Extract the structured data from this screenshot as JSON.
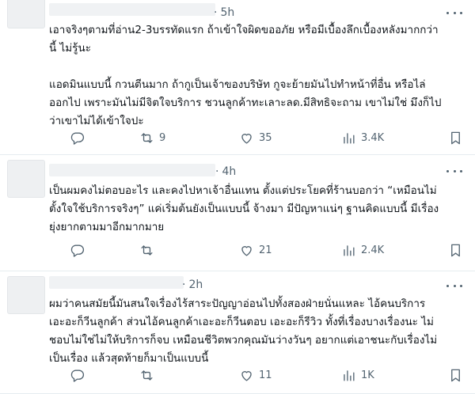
{
  "posts": [
    {
      "time": "5h",
      "lines": [
        "เอาจริงๆตามที่อ่าน2-3บรรทัดแรก ถ้าเข้าใจผิดขออภัย หรือมีเบื้องลึกเบื้องหลังมากกว่า",
        "นี้ ไม่รู้นะ",
        "",
        "แอดมินแบบนี้ กวนตีนมาก ถ้ากูเป็นเจ้าของบริษัท กูจะย้ายมันไปทำหน้าที่อื่น หรือไล่",
        "ออกไป เพราะมันไม่มีจิตใจบริการ ชวนลูกค้าทะเลาะลด.มีสิทธิจะถาม เขาไม่ใช่ มึงก็ไป",
        "ว่าเขาไม่ได้เข้าใจปะ"
      ],
      "replies": "",
      "reposts": "9",
      "likes": "35",
      "views": "3.4K"
    },
    {
      "time": "4h",
      "lines": [
        "เป็นผมคงไม่ตอบอะไร และคงไปหาเจ้าอื่นแทน ตั้งแต่ประโยคที่ร้านบอกว่า “เหมือนไม่",
        "ตั้งใจใช้บริการจริงๆ” แค่เริ่มต้นยังเป็นแบบนี้ จ้างมา มีปัญหาแน่ๆ ฐานคิดแบบนี้ มีเรื่อง",
        "ยุ่งยากตามมาอีกมากมาย"
      ],
      "replies": "",
      "reposts": "",
      "likes": "21",
      "views": "2.4K"
    },
    {
      "time": "2h",
      "lines": [
        "ผมว่าคนสมัยนี้มันสนใจเรื่องไร้สาระปัญญาอ่อนไปทั้งสองฝ่ายนั่นแหละ ไอ้คนบริการ",
        "เอะอะก็วีนลูกค้า ส่วนไอ้คนลูกค้าเอะอะก็วีนตอบ เอะอะก็รีวิว ทั้งที่เรื่องบางเรื่องนะ ไม่",
        "ชอบไม่ใช่ไม่ให้บริการก็จบ เหมือนชีวิตพวกคุณมันว่างวันๆ อยากแต่เอาชนะกับเรื่องไม่",
        "เป็นเรื่อง แล้วสุดท้ายก็มาเป็นแบบนี้"
      ],
      "replies": "",
      "reposts": "",
      "likes": "11",
      "views": "1K"
    }
  ],
  "icons": {
    "reply": "reply-icon",
    "repost": "repost-icon",
    "like": "heart-icon",
    "views": "views-chart-icon",
    "bookmark": "bookmark-icon",
    "share": "share-icon",
    "more": "more-dots-icon"
  },
  "colors": {
    "text": "#0f1419",
    "muted": "#536471",
    "divider": "#e6ecf0"
  }
}
